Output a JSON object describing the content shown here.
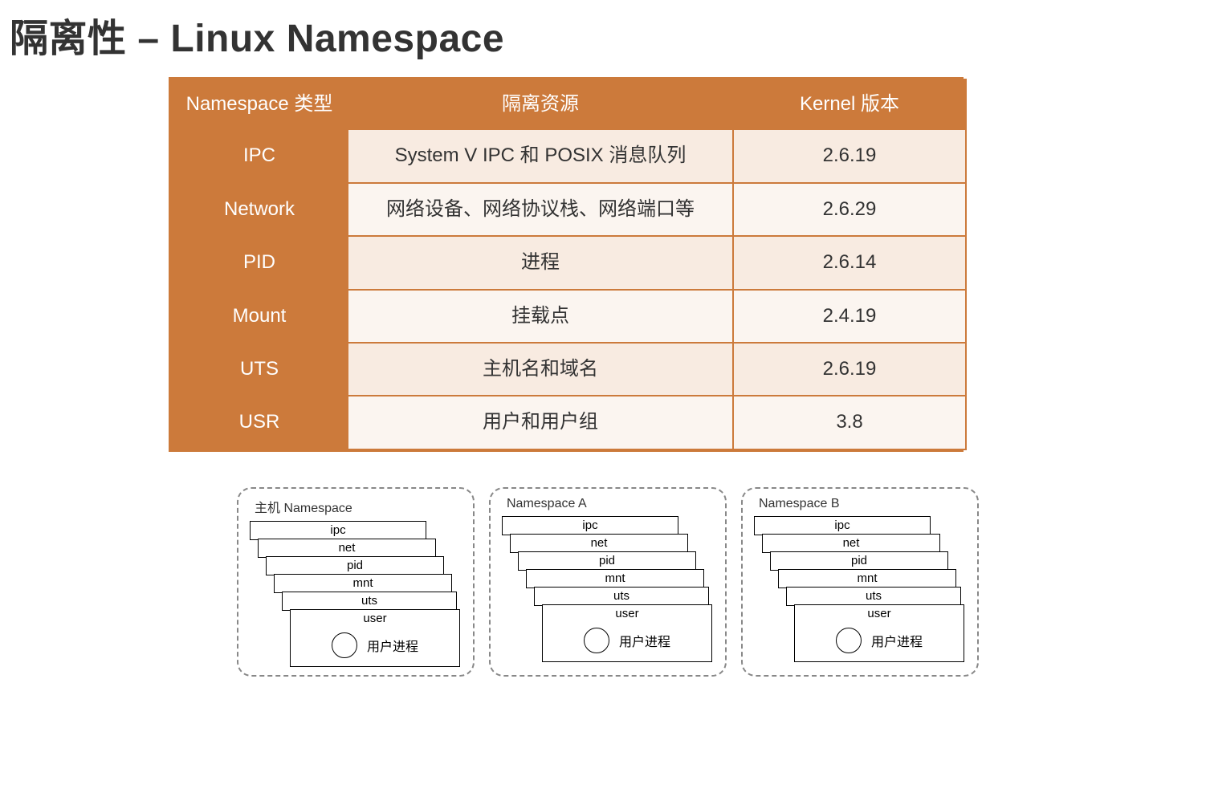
{
  "title": "隔离性 – Linux Namespace",
  "table": {
    "headers": {
      "type": "Namespace 类型",
      "resource": "隔离资源",
      "kernel": "Kernel 版本"
    },
    "rows": [
      {
        "type": "IPC",
        "resource": "System V IPC 和 POSIX 消息队列",
        "kernel": "2.6.19"
      },
      {
        "type": "Network",
        "resource": "网络设备、网络协议栈、网络端口等",
        "kernel": "2.6.29"
      },
      {
        "type": "PID",
        "resource": "进程",
        "kernel": "2.6.14"
      },
      {
        "type": "Mount",
        "resource": "挂载点",
        "kernel": "2.4.19"
      },
      {
        "type": "UTS",
        "resource": "主机名和域名",
        "kernel": "2.6.19"
      },
      {
        "type": "USR",
        "resource": "用户和用户组",
        "kernel": "3.8"
      }
    ]
  },
  "layers": {
    "ipc": "ipc",
    "net": "net",
    "pid": "pid",
    "mnt": "mnt",
    "uts": "uts",
    "user": "user"
  },
  "process_label": "用户进程",
  "namespaces": [
    {
      "title": "主机 Namespace"
    },
    {
      "title": "Namespace A"
    },
    {
      "title": "Namespace B"
    }
  ],
  "colors": {
    "accent": "#cc7a3b",
    "stripe_light": "#fbf5f0",
    "stripe_dark": "#f8ebe1"
  },
  "chart_data": {
    "type": "table",
    "title": "隔离性 – Linux Namespace",
    "columns": [
      "Namespace 类型",
      "隔离资源",
      "Kernel 版本"
    ],
    "rows": [
      [
        "IPC",
        "System V IPC 和 POSIX 消息队列",
        "2.6.19"
      ],
      [
        "Network",
        "网络设备、网络协议栈、网络端口等",
        "2.6.29"
      ],
      [
        "PID",
        "进程",
        "2.6.14"
      ],
      [
        "Mount",
        "挂载点",
        "2.4.19"
      ],
      [
        "UTS",
        "主机名和域名",
        "2.6.19"
      ],
      [
        "USR",
        "用户和用户组",
        "3.8"
      ]
    ]
  }
}
